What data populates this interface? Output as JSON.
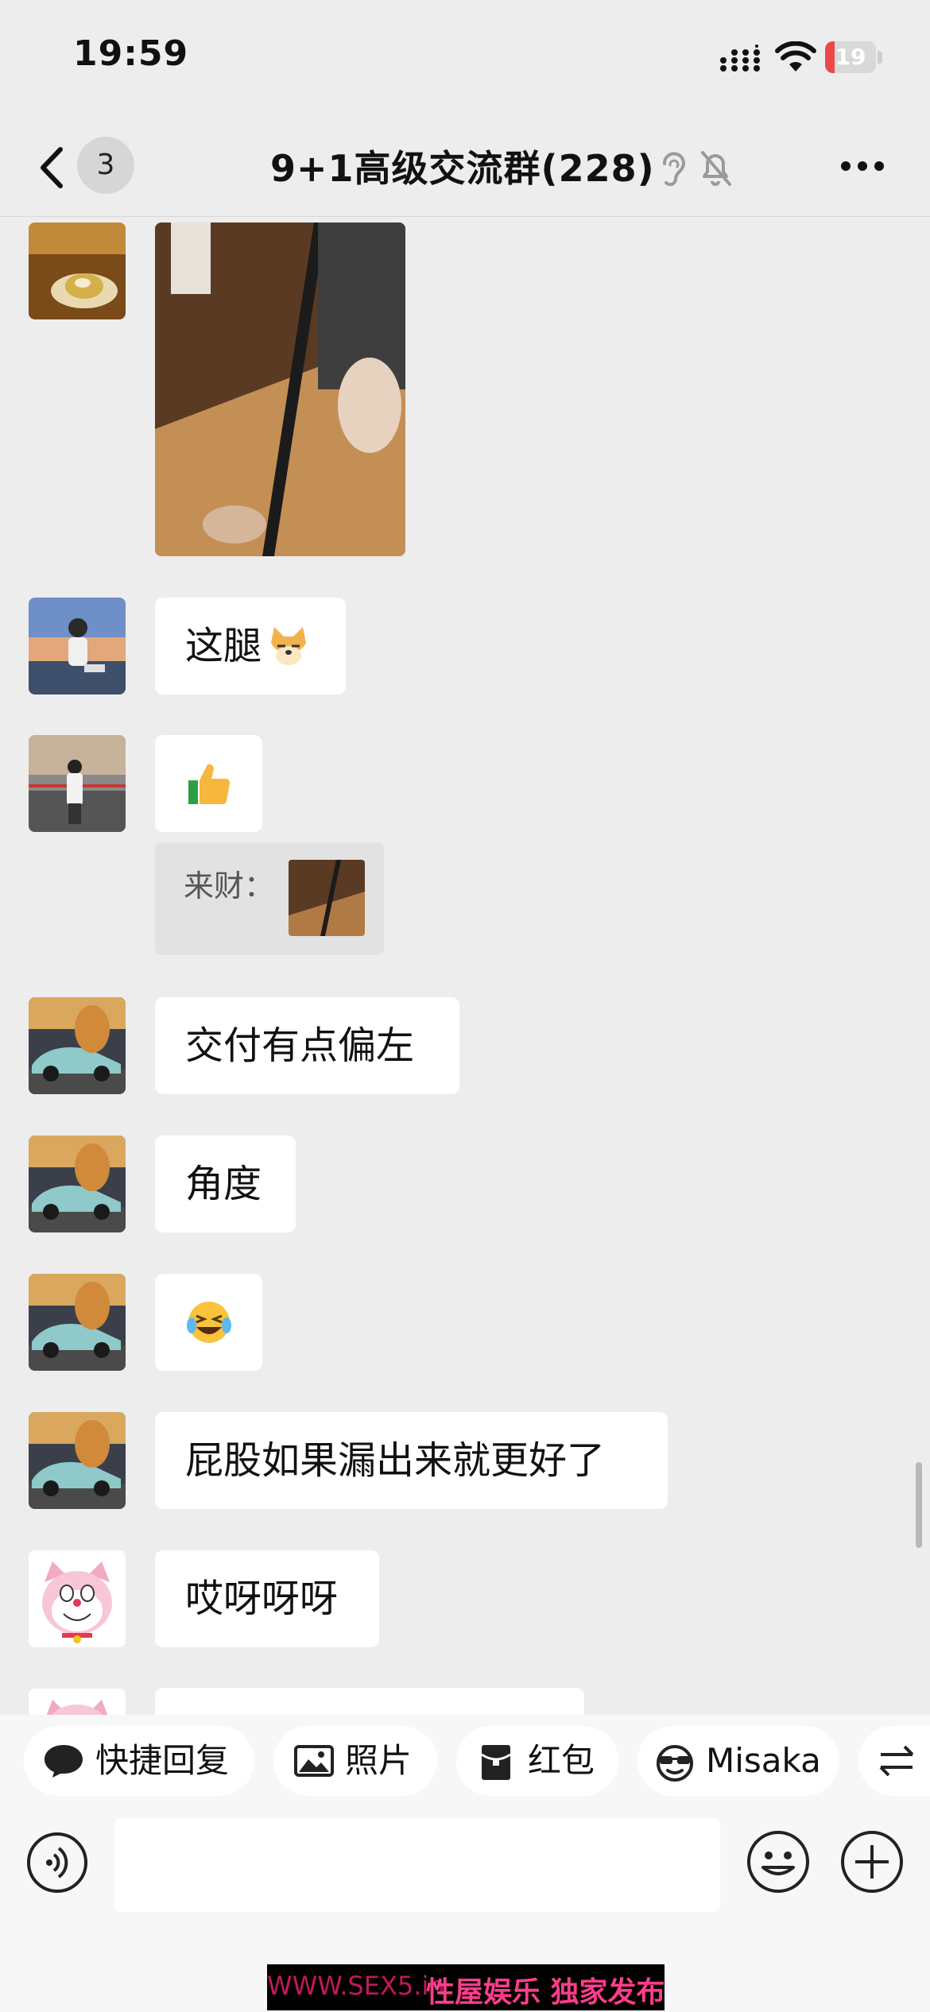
{
  "status": {
    "time": "19:59",
    "battery_level": "19"
  },
  "header": {
    "unread_count": "3",
    "title": "9+1高级交流群(228)"
  },
  "messages": {
    "m1": "这腿",
    "m2_quote_label": "来财：",
    "m3": "交付有点偏左",
    "m4": "角度",
    "m6": "屁股如果漏出来就更好了",
    "m7": "哎呀呀呀"
  },
  "shortcuts": {
    "quick_reply": "快捷回复",
    "photo": "照片",
    "red_packet": "红包",
    "misaka": "Misaka"
  },
  "watermark": {
    "url": "WWW.SEX5.in",
    "tag": "性屋娱乐 独家发布"
  },
  "colors": {
    "background": "#ededed",
    "bubble": "#ffffff",
    "battery_low": "#e84a4a",
    "watermark_text": "#ff3d8a"
  }
}
